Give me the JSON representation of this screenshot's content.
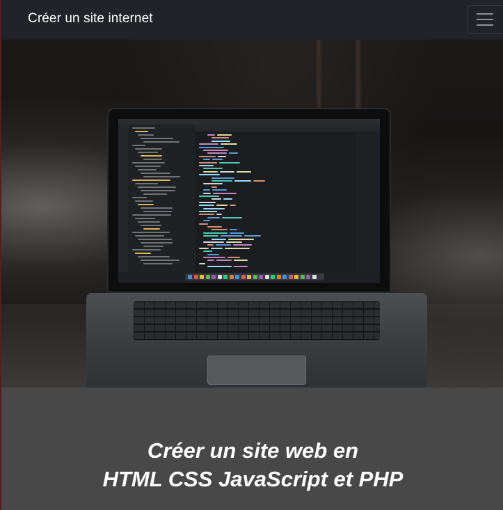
{
  "navbar": {
    "brand": "Créer un site internet",
    "toggle_icon": "hamburger-menu-icon"
  },
  "hero": {
    "image_subject": "laptop-with-code-editor"
  },
  "headline": {
    "line1": "Créer un site web en",
    "line2": "HTML CSS JavaScript et PHP"
  },
  "colors": {
    "navbar_bg": "#202327",
    "bottom_bg": "#484848",
    "text": "#ffffff"
  }
}
